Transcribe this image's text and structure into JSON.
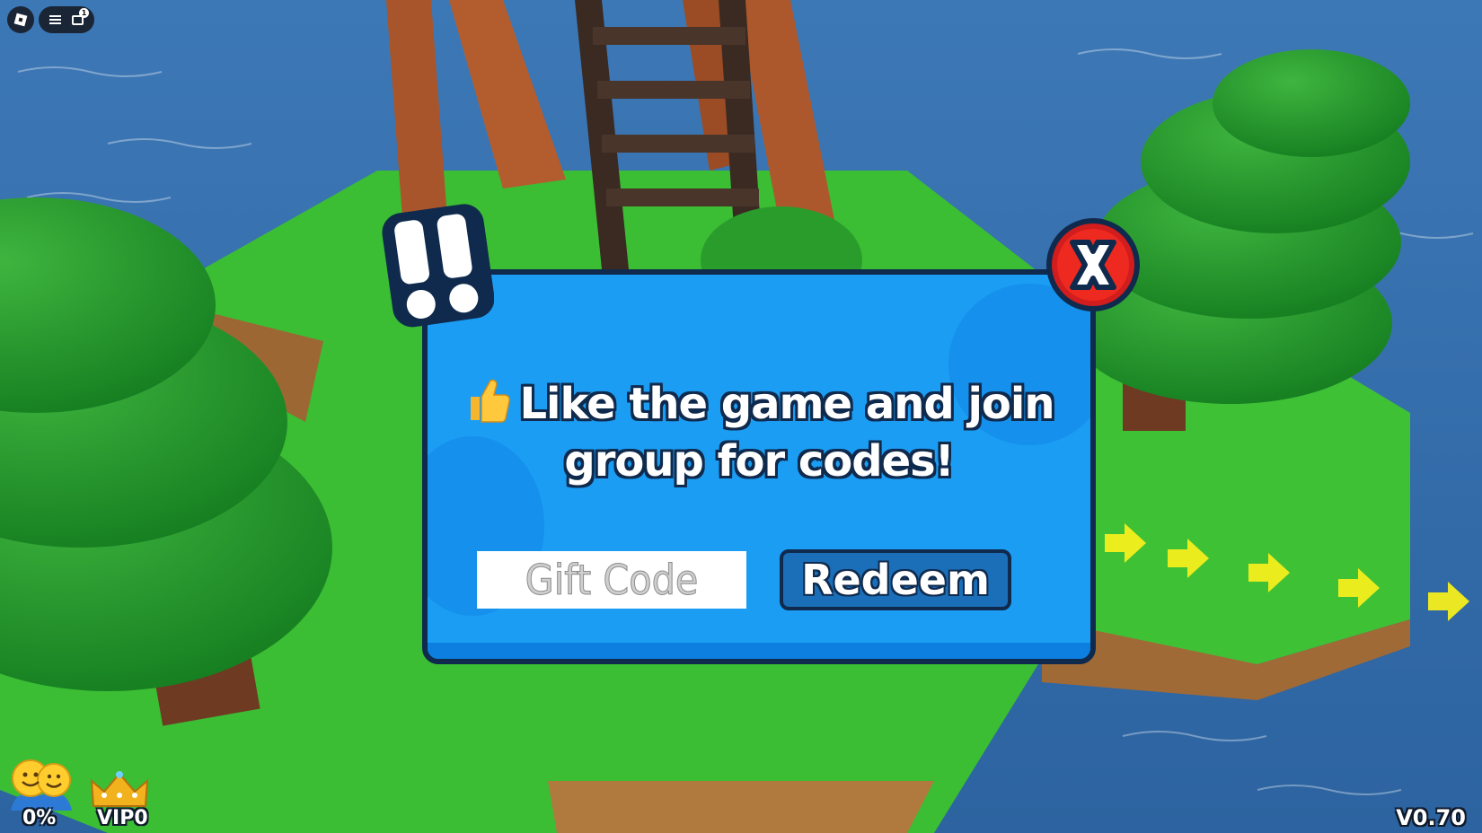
{
  "popup": {
    "message": "Like the game and join group for codes!",
    "code_placeholder": "Gift Code",
    "redeem_label": "Redeem"
  },
  "hud": {
    "players_percent": "0%",
    "vip_label": "VIP0",
    "version": "V0.70",
    "chat_badge_count": "1"
  },
  "icons": {
    "attention": "double-exclamation-icon",
    "close": "close-x-icon",
    "thumbs_up": "thumbs-up-icon",
    "players": "smiley-players-icon",
    "vip": "crown-icon"
  },
  "colors": {
    "panel": "#1b9df4",
    "panel_border": "#0f2a4d",
    "close_red": "#e2231a",
    "redeem_button": "#1a6fb8"
  }
}
